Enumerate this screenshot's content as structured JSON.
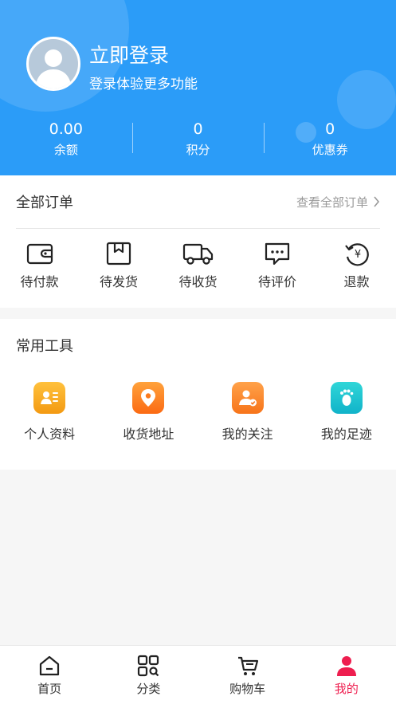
{
  "header": {
    "title": "立即登录",
    "subtitle": "登录体验更多功能",
    "bg_color": "#2b9cf8",
    "avatar_icon": "user-avatar-icon"
  },
  "stats": [
    {
      "value": "0.00",
      "label": "余额"
    },
    {
      "value": "0",
      "label": "积分"
    },
    {
      "value": "0",
      "label": "优惠券"
    }
  ],
  "orders": {
    "title": "全部订单",
    "more_label": "查看全部订单",
    "items": [
      {
        "label": "待付款",
        "icon": "wallet-icon"
      },
      {
        "label": "待发货",
        "icon": "package-icon"
      },
      {
        "label": "待收货",
        "icon": "truck-icon"
      },
      {
        "label": "待评价",
        "icon": "comment-icon"
      },
      {
        "label": "退款",
        "icon": "refund-icon"
      }
    ]
  },
  "tools": {
    "title": "常用工具",
    "items": [
      {
        "label": "个人资料",
        "icon": "profile-card-icon",
        "color": "#f5a623"
      },
      {
        "label": "收货地址",
        "icon": "location-pin-icon",
        "color": "#ff7a1a"
      },
      {
        "label": "我的关注",
        "icon": "follow-user-icon",
        "color": "#ff8a1e"
      },
      {
        "label": "我的足迹",
        "icon": "footprint-icon",
        "color": "#1dc9c9"
      }
    ]
  },
  "tabbar": {
    "items": [
      {
        "label": "首页",
        "icon": "home-icon",
        "active": false
      },
      {
        "label": "分类",
        "icon": "category-icon",
        "active": false
      },
      {
        "label": "购物车",
        "icon": "cart-icon",
        "active": false
      },
      {
        "label": "我的",
        "icon": "profile-icon",
        "active": true
      }
    ],
    "active_color": "#ee1e4f"
  }
}
